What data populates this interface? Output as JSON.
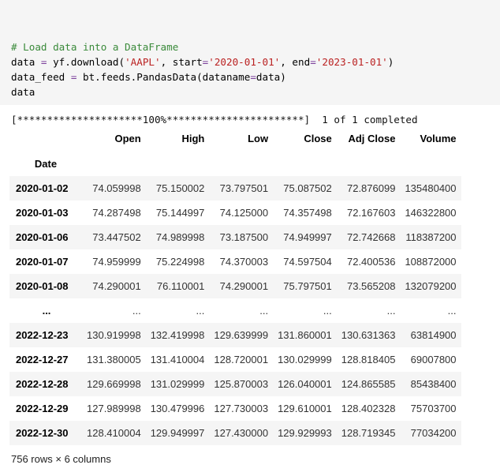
{
  "code_cell": {
    "comment": "# Load data into a DataFrame",
    "line2": {
      "a": "data ",
      "eq": "=",
      "b": " yf.download(",
      "s1": "'AAPL'",
      "c": ", start",
      "eq2": "=",
      "s2": "'2020-01-01'",
      "d": ", end",
      "eq3": "=",
      "s3": "'2023-01-01'",
      "e": ")"
    },
    "line3": {
      "a": "data_feed ",
      "eq": "=",
      "b": " bt.feeds.PandasData(dataname",
      "eq2": "=",
      "c": "data)"
    },
    "line4": "data"
  },
  "progress_text": "[*********************100%***********************]  1 of 1 completed",
  "table": {
    "columns": [
      "Open",
      "High",
      "Low",
      "Close",
      "Adj Close",
      "Volume"
    ],
    "index_name": "Date",
    "rows": [
      {
        "date": "2020-01-02",
        "values": [
          "74.059998",
          "75.150002",
          "73.797501",
          "75.087502",
          "72.876099",
          "135480400"
        ]
      },
      {
        "date": "2020-01-03",
        "values": [
          "74.287498",
          "75.144997",
          "74.125000",
          "74.357498",
          "72.167603",
          "146322800"
        ]
      },
      {
        "date": "2020-01-06",
        "values": [
          "73.447502",
          "74.989998",
          "73.187500",
          "74.949997",
          "72.742668",
          "118387200"
        ]
      },
      {
        "date": "2020-01-07",
        "values": [
          "74.959999",
          "75.224998",
          "74.370003",
          "74.597504",
          "72.400536",
          "108872000"
        ]
      },
      {
        "date": "2020-01-08",
        "values": [
          "74.290001",
          "76.110001",
          "74.290001",
          "75.797501",
          "73.565208",
          "132079200"
        ]
      },
      {
        "date": "...",
        "values": [
          "...",
          "...",
          "...",
          "...",
          "...",
          "..."
        ]
      },
      {
        "date": "2022-12-23",
        "values": [
          "130.919998",
          "132.419998",
          "129.639999",
          "131.860001",
          "130.631363",
          "63814900"
        ]
      },
      {
        "date": "2022-12-27",
        "values": [
          "131.380005",
          "131.410004",
          "128.720001",
          "130.029999",
          "128.818405",
          "69007800"
        ]
      },
      {
        "date": "2022-12-28",
        "values": [
          "129.669998",
          "131.029999",
          "125.870003",
          "126.040001",
          "124.865585",
          "85438400"
        ]
      },
      {
        "date": "2022-12-29",
        "values": [
          "127.989998",
          "130.479996",
          "127.730003",
          "129.610001",
          "128.402328",
          "75703700"
        ]
      },
      {
        "date": "2022-12-30",
        "values": [
          "128.410004",
          "129.949997",
          "127.430000",
          "129.929993",
          "128.719345",
          "77034200"
        ]
      }
    ]
  },
  "footer_text": "756 rows × 6 columns"
}
